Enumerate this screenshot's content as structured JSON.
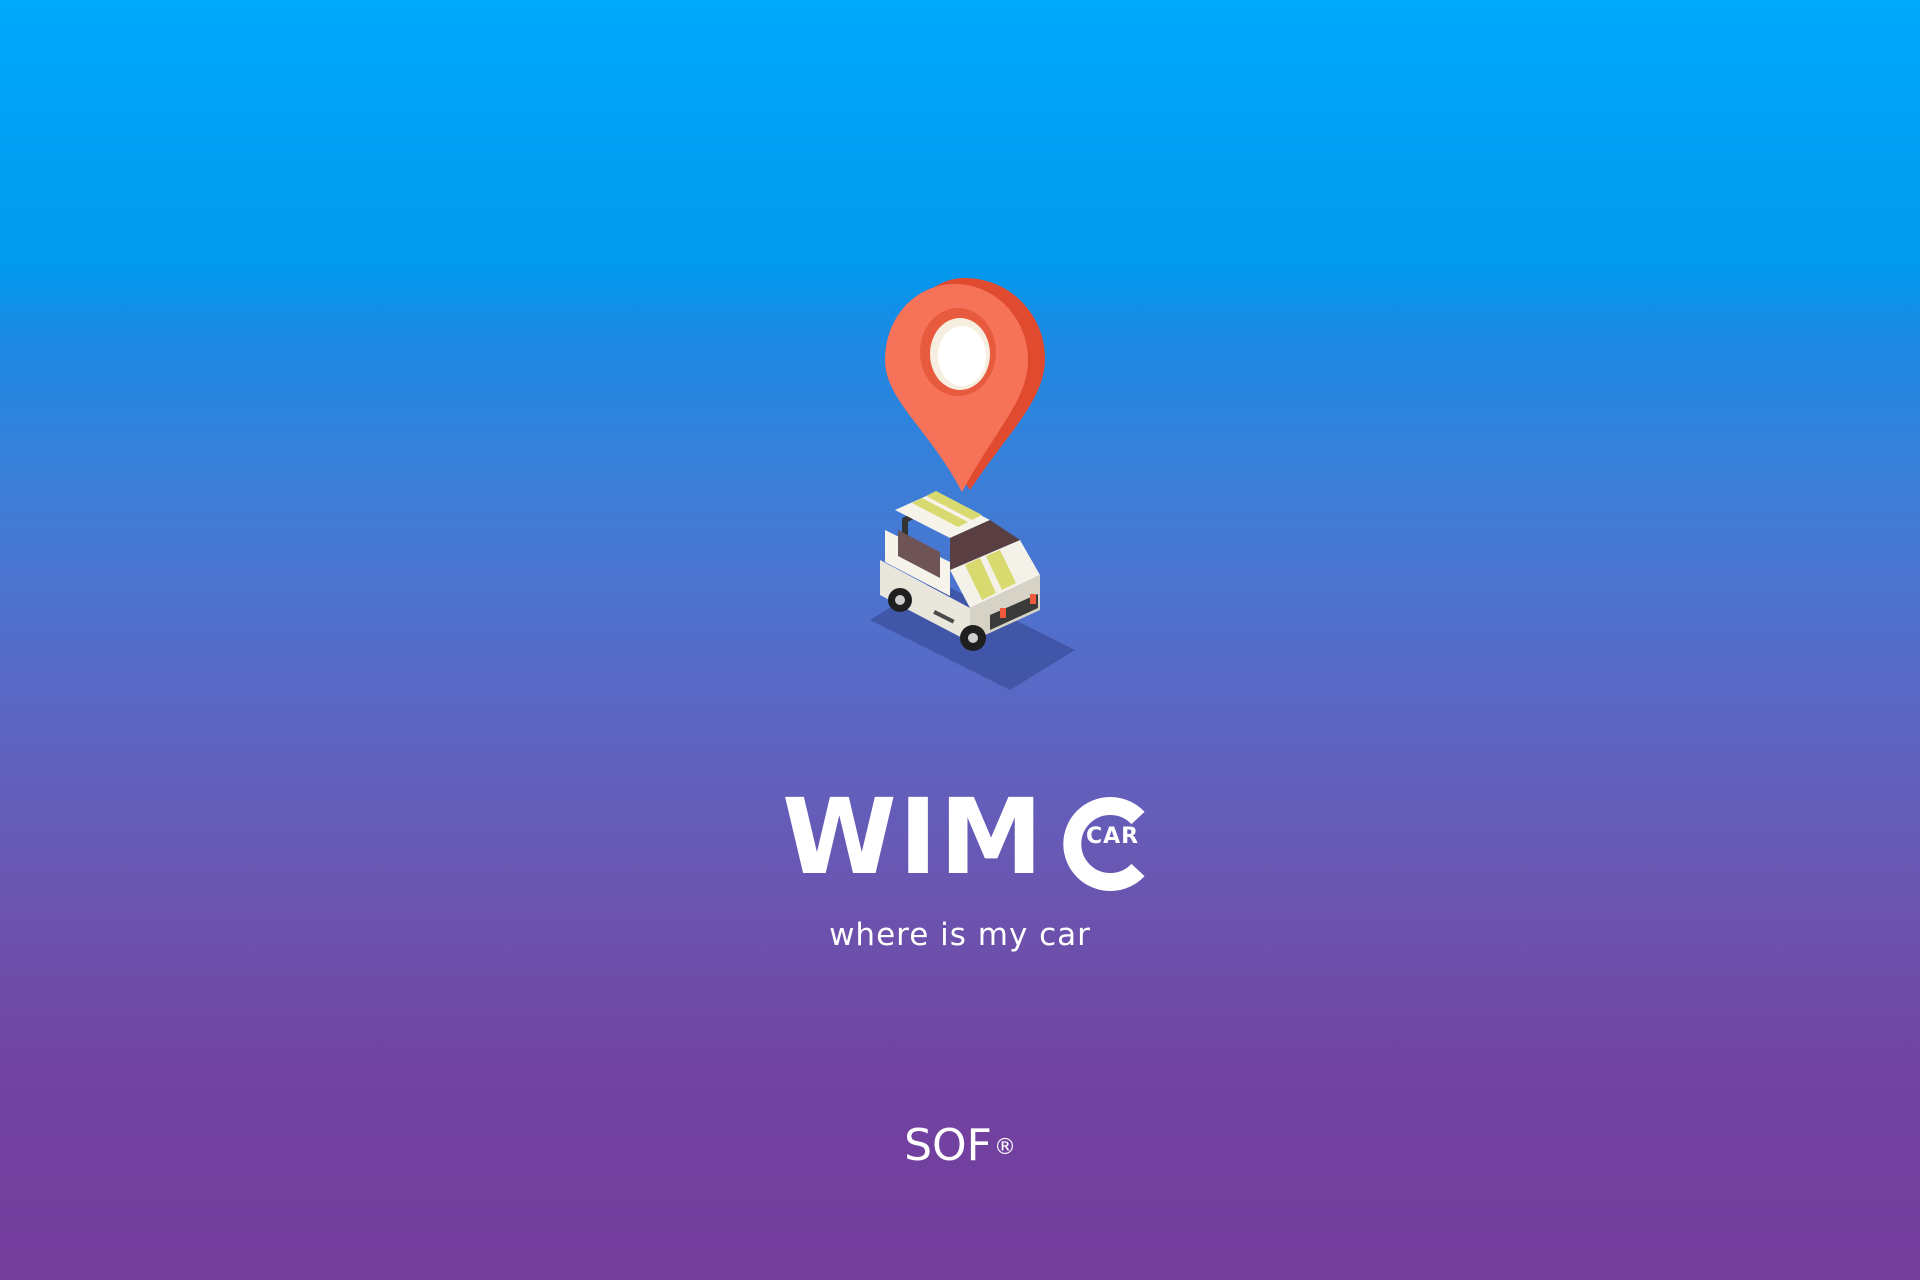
{
  "splash": {
    "logo_main": "WIM",
    "logo_sub": "CAR",
    "tagline": "where is my car",
    "brand": "SOF",
    "brand_mark": "®"
  },
  "icons": {
    "pin": "map-pin-icon",
    "car": "car-illustration"
  },
  "colors": {
    "bg_top": "#00a9fb",
    "bg_bottom": "#733d9c",
    "pin": "#f25a3c",
    "text": "#ffffff"
  }
}
